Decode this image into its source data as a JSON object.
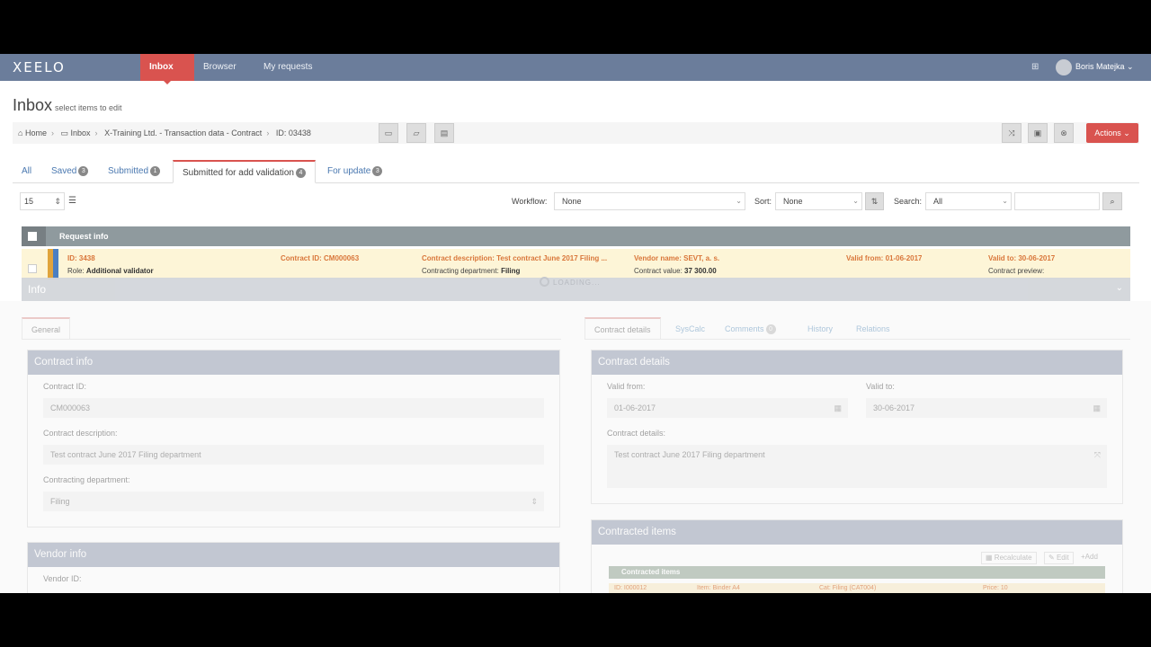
{
  "app": {
    "logo": "XEELO"
  },
  "nav": {
    "items": [
      {
        "label": "Inbox"
      },
      {
        "label": "Browser"
      },
      {
        "label": "My requests"
      }
    ],
    "user_name": "Boris Matejka"
  },
  "page": {
    "title": "Inbox",
    "subtitle": "select items to edit"
  },
  "breadcrumb": {
    "home": "Home",
    "inbox": "Inbox",
    "entity": "X-Training Ltd. - Transaction data - Contract",
    "id": "ID: 03438"
  },
  "toolbar": {
    "actions_label": "Actions"
  },
  "tabs": [
    {
      "label": "All",
      "count": ""
    },
    {
      "label": "Saved",
      "count": "3"
    },
    {
      "label": "Submitted",
      "count": "1"
    },
    {
      "label": "Submitted for add validation",
      "count": "4"
    },
    {
      "label": "For update",
      "count": "3"
    }
  ],
  "filters": {
    "page_size": "15",
    "workflow_label": "Workflow:",
    "workflow_value": "None",
    "sort_label": "Sort:",
    "sort_value": "None",
    "search_label": "Search:",
    "search_scope": "All"
  },
  "table": {
    "header": "Request info",
    "row": {
      "id": "ID: 3438",
      "role_label": "Role:",
      "role_value": "Additional validator",
      "contract_id": "Contract ID: CM000063",
      "description": "Contract description: Test contract June 2017 Filing ...",
      "dept_label": "Contracting department:",
      "dept_value": "Filing",
      "vendor": "Vendor name: SEVT, a. s.",
      "value_label": "Contract value:",
      "value_value": "37 300.00",
      "valid_from": "Valid from: 01-06-2017",
      "valid_to": "Valid to: 30-06-2017",
      "preview": "Contract preview:"
    }
  },
  "info": {
    "title": "Info",
    "loading": "LOADING..."
  },
  "left_tabs": [
    {
      "label": "General"
    }
  ],
  "right_tabs": [
    {
      "label": "Contract details",
      "count": ""
    },
    {
      "label": "SysCalc",
      "count": ""
    },
    {
      "label": "Comments",
      "count": "0"
    },
    {
      "label": "History",
      "count": ""
    },
    {
      "label": "Relations",
      "count": ""
    }
  ],
  "contract_info": {
    "title": "Contract info",
    "contract_id_label": "Contract ID:",
    "contract_id": "CM000063",
    "description_label": "Contract description:",
    "description": "Test contract June 2017 Filing department",
    "dept_label": "Contracting department:",
    "dept": "Filing"
  },
  "vendor_info": {
    "title": "Vendor info",
    "vendor_id_label": "Vendor ID:"
  },
  "contract_details": {
    "title": "Contract details",
    "valid_from_label": "Valid from:",
    "valid_from": "01-06-2017",
    "valid_to_label": "Valid to:",
    "valid_to": "30-06-2017",
    "details_label": "Contract details:",
    "details": "Test contract June 2017 Filing department"
  },
  "contracted_items": {
    "title": "Contracted items",
    "recalculate": "Recalculate",
    "edit": "Edit",
    "add": "Add",
    "table_title": "Contracted items",
    "row": {
      "id": "ID: I000012",
      "item": "Item: Binder A4",
      "cat": "Cat: Filing (CAT004)",
      "price": "Price: 10"
    }
  }
}
